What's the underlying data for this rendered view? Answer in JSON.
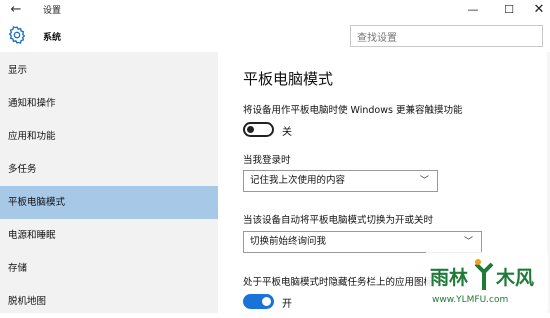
{
  "window": {
    "title": "设置",
    "back_icon": "back-arrow-icon",
    "minimize_glyph": "—",
    "maximize_glyph": "☐",
    "close_glyph": "✕"
  },
  "header": {
    "section_title": "系统",
    "section_icon": "gear-icon",
    "search_placeholder": "查找设置"
  },
  "sidebar": {
    "items": [
      {
        "label": "显示",
        "active": false
      },
      {
        "label": "通知和操作",
        "active": false
      },
      {
        "label": "应用和功能",
        "active": false
      },
      {
        "label": "多任务",
        "active": false
      },
      {
        "label": "平板电脑模式",
        "active": true
      },
      {
        "label": "电源和睡眠",
        "active": false
      },
      {
        "label": "存储",
        "active": false
      },
      {
        "label": "脱机地图",
        "active": false
      }
    ]
  },
  "main": {
    "page_title": "平板电脑模式",
    "touch_setting": {
      "label": "将设备用作平板电脑时使 Windows 更兼容触摸功能",
      "toggle_state": "off",
      "toggle_text": "关"
    },
    "signin_setting": {
      "label": "当我登录时",
      "selected": "记住我上次使用的内容"
    },
    "auto_switch_setting": {
      "label": "当该设备自动将平板电脑模式切换为开或关时",
      "selected": "切换前始终询问我"
    },
    "taskbar_setting": {
      "label": "处于平板电脑模式时隐藏任务栏上的应用图标",
      "toggle_state": "on",
      "toggle_text": "开"
    }
  },
  "watermark": {
    "brand": "雨林木风",
    "url": "www.YLMFU.com"
  },
  "colors": {
    "sidebar_bg": "#f2f2f2",
    "active_item_bg": "#a8c8e8",
    "toggle_on": "#1a73d9",
    "watermark_green": "#1f7a3a"
  }
}
